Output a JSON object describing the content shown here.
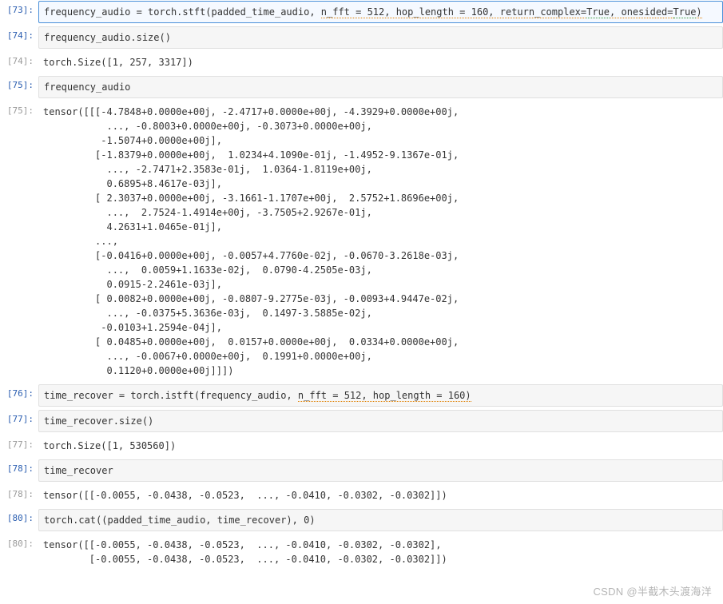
{
  "cells": [
    {
      "n": "73",
      "in": "frequency_audio = torch.stft(padded_time_audio, ",
      "hint": "n_fft = 512, hop_length = 160, return_complex=True, onesided=True)",
      "selected": true
    },
    {
      "n": "74",
      "in": "frequency_audio.size()"
    },
    {
      "n": "74",
      "out": "torch.Size([1, 257, 3317])"
    },
    {
      "n": "75",
      "in": "frequency_audio"
    },
    {
      "n": "75",
      "out": "tensor([[[-4.7848+0.0000e+00j, -2.4717+0.0000e+00j, -4.3929+0.0000e+00j,\n           ..., -0.8003+0.0000e+00j, -0.3073+0.0000e+00j,\n          -1.5074+0.0000e+00j],\n         [-1.8379+0.0000e+00j,  1.0234+4.1090e-01j, -1.4952-9.1367e-01j,\n           ..., -2.7471+2.3583e-01j,  1.0364-1.8119e+00j,\n           0.6895+8.4617e-03j],\n         [ 2.3037+0.0000e+00j, -3.1661-1.1707e+00j,  2.5752+1.8696e+00j,\n           ...,  2.7524-1.4914e+00j, -3.7505+2.9267e-01j,\n           4.2631+1.0465e-01j],\n         ...,\n         [-0.0416+0.0000e+00j, -0.0057+4.7760e-02j, -0.0670-3.2618e-03j,\n           ...,  0.0059+1.1633e-02j,  0.0790-4.2505e-03j,\n           0.0915-2.2461e-03j],\n         [ 0.0082+0.0000e+00j, -0.0807-9.2775e-03j, -0.0093+4.9447e-02j,\n           ..., -0.0375+5.3636e-03j,  0.1497-3.5885e-02j,\n          -0.0103+1.2594e-04j],\n         [ 0.0485+0.0000e+00j,  0.0157+0.0000e+00j,  0.0334+0.0000e+00j,\n           ..., -0.0067+0.0000e+00j,  0.1991+0.0000e+00j,\n           0.1120+0.0000e+00j]]])"
    },
    {
      "n": "76",
      "in": "time_recover = torch.istft(frequency_audio, ",
      "hint": "n_fft = 512, hop_length = 160)"
    },
    {
      "n": "77",
      "in": "time_recover.size()"
    },
    {
      "n": "77",
      "out": "torch.Size([1, 530560])"
    },
    {
      "n": "78",
      "in": "time_recover"
    },
    {
      "n": "78",
      "out": "tensor([[-0.0055, -0.0438, -0.0523,  ..., -0.0410, -0.0302, -0.0302]])"
    },
    {
      "n": "80",
      "in": "torch.cat((padded_time_audio, time_recover), 0)"
    },
    {
      "n": "80",
      "out": "tensor([[-0.0055, -0.0438, -0.0523,  ..., -0.0410, -0.0302, -0.0302],\n        [-0.0055, -0.0438, -0.0523,  ..., -0.0410, -0.0302, -0.0302]])"
    }
  ],
  "watermark": "CSDN @半截木头渡海洋"
}
